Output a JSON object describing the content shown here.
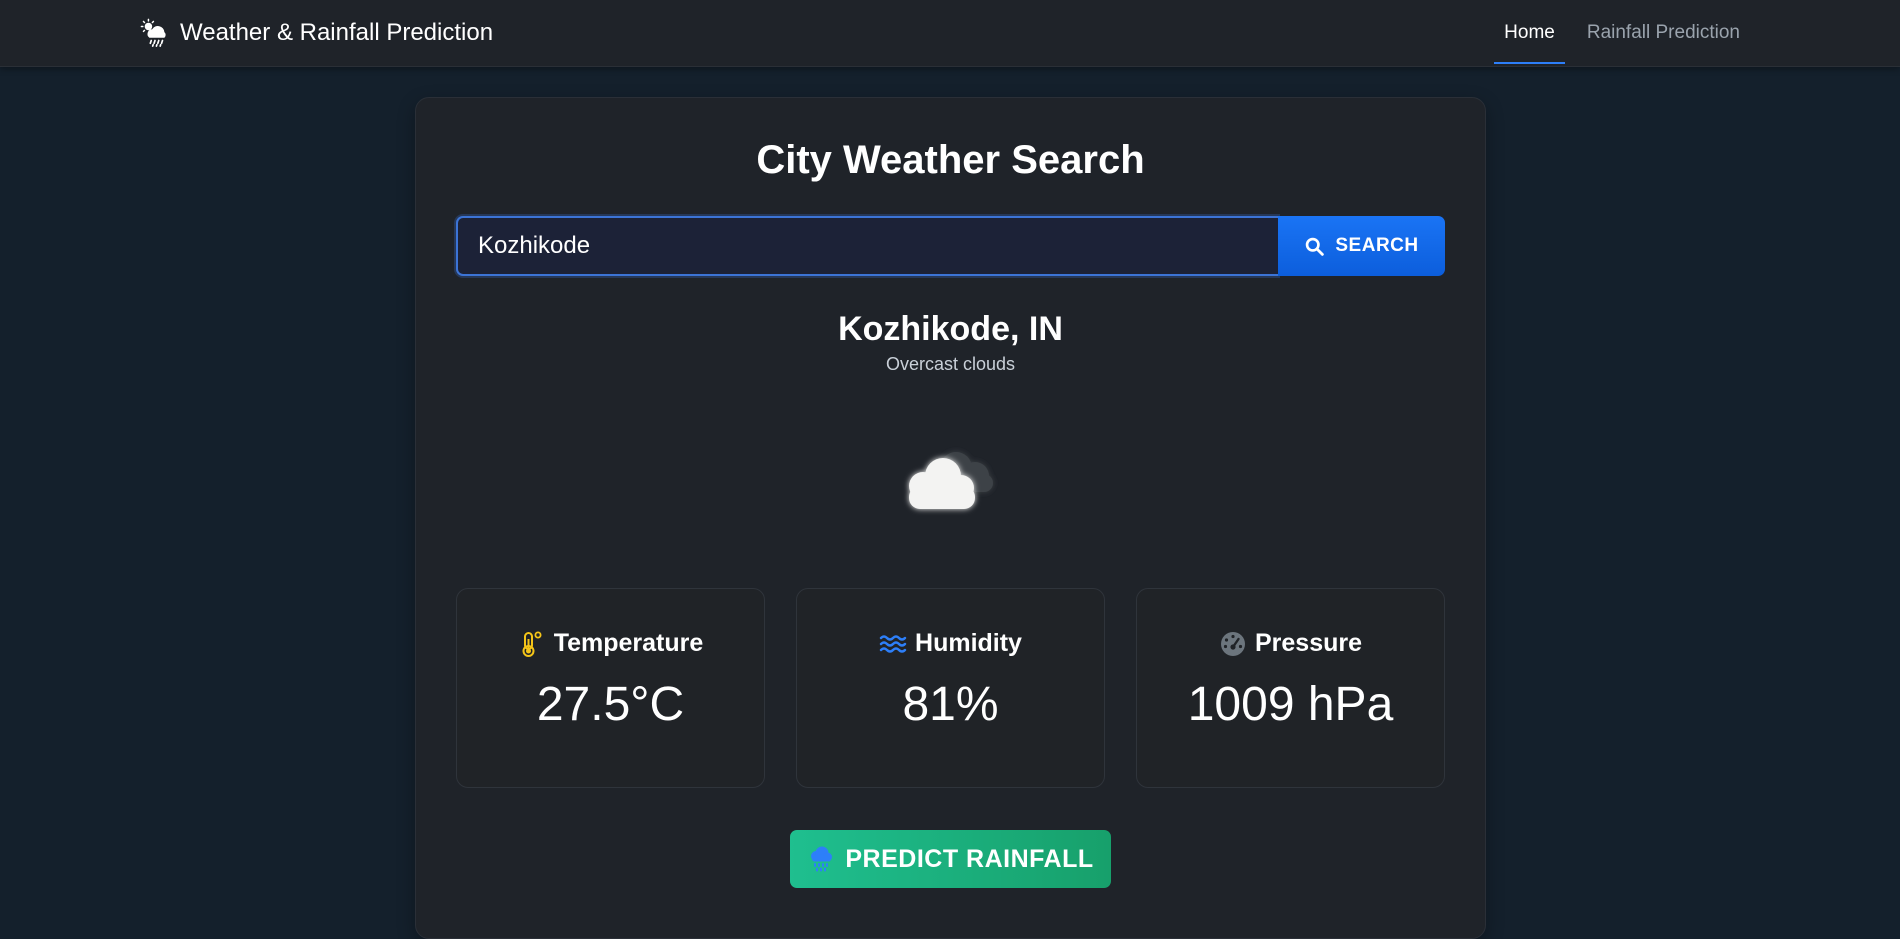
{
  "navbar": {
    "brand": "Weather & Rainfall Prediction",
    "brand_icon": "cloud-sun-rain-icon",
    "links": [
      {
        "label": "Home",
        "active": true
      },
      {
        "label": "Rainfall Prediction",
        "active": false
      }
    ]
  },
  "search": {
    "title": "City Weather Search",
    "input_value": "Kozhikode",
    "button_label": "SEARCH",
    "button_icon": "search-icon"
  },
  "weather": {
    "location": "Kozhikode, IN",
    "description": "Overcast clouds",
    "icon": "overcast-clouds-icon"
  },
  "stats": [
    {
      "label": "Temperature",
      "value": "27.5°C",
      "icon": "thermometer-icon",
      "icon_color": "#f5c518"
    },
    {
      "label": "Humidity",
      "value": "81%",
      "icon": "water-waves-icon",
      "icon_color": "#2d7ff9"
    },
    {
      "label": "Pressure",
      "value": "1009 hPa",
      "icon": "gauge-icon",
      "icon_color": "#6c757d"
    }
  ],
  "actions": {
    "predict_label": "PREDICT RAINFALL",
    "predict_icon": "cloud-rain-icon"
  },
  "colors": {
    "accent": "#0d6efd",
    "success": "#1fbf8f",
    "background": "#14202c",
    "card": "#1f2329"
  }
}
